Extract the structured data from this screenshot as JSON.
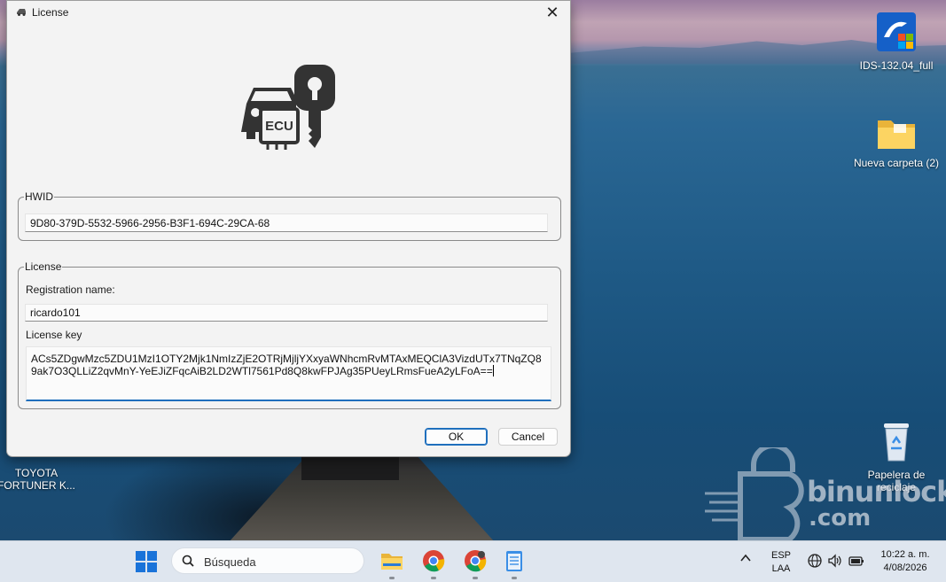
{
  "dialog": {
    "title": "License",
    "close_glyph": "✕",
    "logo_text": "ECU",
    "hwid": {
      "legend": "HWID",
      "value": "9D80-379D-5532-5966-2956-B3F1-694C-29CA-68"
    },
    "license": {
      "legend": "License",
      "registration_label": "Registration name:",
      "registration_value": "ricardo101",
      "key_label": "License key",
      "key_value": "ACs5ZDgwMzc5ZDU1MzI1OTY2Mjk1NmIzZjE2OTRjMjljYXxyaWNhcmRvMTAxMEQClA3VizdUTx7TNqZQ89ak7O3QLLiZ2qvMnY-YeEJiZFqcAiB2LD2WTl7561Pd8Q8kwFPJAg35PUeyLRmsFueA2yLFoA=="
    },
    "ok_label": "OK",
    "cancel_label": "Cancel"
  },
  "desktop": {
    "icons": [
      {
        "label": "IDS-132.04_full",
        "icon": "installer-icon"
      },
      {
        "label": "Nueva carpeta (2)",
        "icon": "folder-icon"
      },
      {
        "label": "Papelera de reciclaje",
        "icon": "recycle-bin-icon"
      },
      {
        "label": "TOYOTA FORTUNER K...",
        "icon": "file-icon"
      }
    ],
    "watermark": {
      "line1": "binunlock",
      "line2": ".com"
    }
  },
  "taskbar": {
    "search_placeholder": "Búsqueda",
    "apps": [
      "file-explorer-icon",
      "chrome-icon",
      "chrome-alt-icon",
      "notepad-icon"
    ],
    "tray": {
      "lang_line1": "ESP",
      "lang_line2": "LAA",
      "time": "10:22 a. m.",
      "date": "4/08/2026"
    }
  },
  "colors": {
    "accent": "#1f6fbd",
    "dialog_bg": "#f3f3f3",
    "taskbar_bg": "#dfe6ef"
  }
}
